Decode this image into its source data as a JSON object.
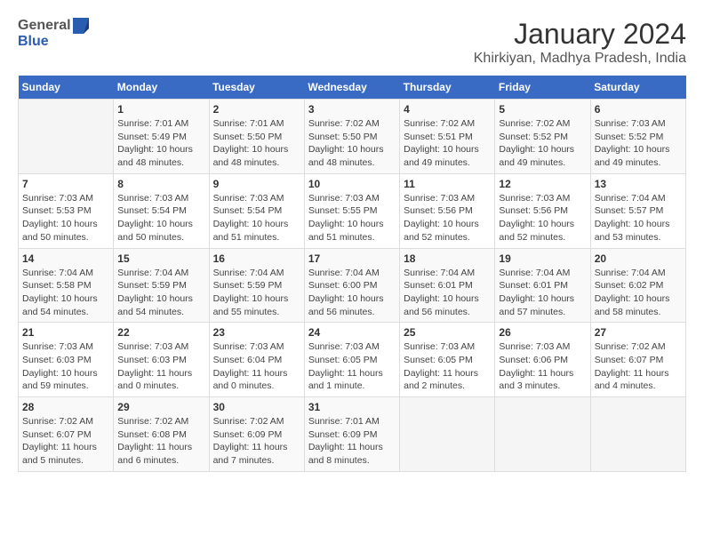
{
  "logo": {
    "line1": "General",
    "line2": "Blue"
  },
  "title": "January 2024",
  "subtitle": "Khirkiyan, Madhya Pradesh, India",
  "headers": [
    "Sunday",
    "Monday",
    "Tuesday",
    "Wednesday",
    "Thursday",
    "Friday",
    "Saturday"
  ],
  "weeks": [
    [
      {
        "day": "",
        "info": ""
      },
      {
        "day": "1",
        "info": "Sunrise: 7:01 AM\nSunset: 5:49 PM\nDaylight: 10 hours\nand 48 minutes."
      },
      {
        "day": "2",
        "info": "Sunrise: 7:01 AM\nSunset: 5:50 PM\nDaylight: 10 hours\nand 48 minutes."
      },
      {
        "day": "3",
        "info": "Sunrise: 7:02 AM\nSunset: 5:50 PM\nDaylight: 10 hours\nand 48 minutes."
      },
      {
        "day": "4",
        "info": "Sunrise: 7:02 AM\nSunset: 5:51 PM\nDaylight: 10 hours\nand 49 minutes."
      },
      {
        "day": "5",
        "info": "Sunrise: 7:02 AM\nSunset: 5:52 PM\nDaylight: 10 hours\nand 49 minutes."
      },
      {
        "day": "6",
        "info": "Sunrise: 7:03 AM\nSunset: 5:52 PM\nDaylight: 10 hours\nand 49 minutes."
      }
    ],
    [
      {
        "day": "7",
        "info": "Sunrise: 7:03 AM\nSunset: 5:53 PM\nDaylight: 10 hours\nand 50 minutes."
      },
      {
        "day": "8",
        "info": "Sunrise: 7:03 AM\nSunset: 5:54 PM\nDaylight: 10 hours\nand 50 minutes."
      },
      {
        "day": "9",
        "info": "Sunrise: 7:03 AM\nSunset: 5:54 PM\nDaylight: 10 hours\nand 51 minutes."
      },
      {
        "day": "10",
        "info": "Sunrise: 7:03 AM\nSunset: 5:55 PM\nDaylight: 10 hours\nand 51 minutes."
      },
      {
        "day": "11",
        "info": "Sunrise: 7:03 AM\nSunset: 5:56 PM\nDaylight: 10 hours\nand 52 minutes."
      },
      {
        "day": "12",
        "info": "Sunrise: 7:03 AM\nSunset: 5:56 PM\nDaylight: 10 hours\nand 52 minutes."
      },
      {
        "day": "13",
        "info": "Sunrise: 7:04 AM\nSunset: 5:57 PM\nDaylight: 10 hours\nand 53 minutes."
      }
    ],
    [
      {
        "day": "14",
        "info": "Sunrise: 7:04 AM\nSunset: 5:58 PM\nDaylight: 10 hours\nand 54 minutes."
      },
      {
        "day": "15",
        "info": "Sunrise: 7:04 AM\nSunset: 5:59 PM\nDaylight: 10 hours\nand 54 minutes."
      },
      {
        "day": "16",
        "info": "Sunrise: 7:04 AM\nSunset: 5:59 PM\nDaylight: 10 hours\nand 55 minutes."
      },
      {
        "day": "17",
        "info": "Sunrise: 7:04 AM\nSunset: 6:00 PM\nDaylight: 10 hours\nand 56 minutes."
      },
      {
        "day": "18",
        "info": "Sunrise: 7:04 AM\nSunset: 6:01 PM\nDaylight: 10 hours\nand 56 minutes."
      },
      {
        "day": "19",
        "info": "Sunrise: 7:04 AM\nSunset: 6:01 PM\nDaylight: 10 hours\nand 57 minutes."
      },
      {
        "day": "20",
        "info": "Sunrise: 7:04 AM\nSunset: 6:02 PM\nDaylight: 10 hours\nand 58 minutes."
      }
    ],
    [
      {
        "day": "21",
        "info": "Sunrise: 7:03 AM\nSunset: 6:03 PM\nDaylight: 10 hours\nand 59 minutes."
      },
      {
        "day": "22",
        "info": "Sunrise: 7:03 AM\nSunset: 6:03 PM\nDaylight: 11 hours\nand 0 minutes."
      },
      {
        "day": "23",
        "info": "Sunrise: 7:03 AM\nSunset: 6:04 PM\nDaylight: 11 hours\nand 0 minutes."
      },
      {
        "day": "24",
        "info": "Sunrise: 7:03 AM\nSunset: 6:05 PM\nDaylight: 11 hours\nand 1 minute."
      },
      {
        "day": "25",
        "info": "Sunrise: 7:03 AM\nSunset: 6:05 PM\nDaylight: 11 hours\nand 2 minutes."
      },
      {
        "day": "26",
        "info": "Sunrise: 7:03 AM\nSunset: 6:06 PM\nDaylight: 11 hours\nand 3 minutes."
      },
      {
        "day": "27",
        "info": "Sunrise: 7:02 AM\nSunset: 6:07 PM\nDaylight: 11 hours\nand 4 minutes."
      }
    ],
    [
      {
        "day": "28",
        "info": "Sunrise: 7:02 AM\nSunset: 6:07 PM\nDaylight: 11 hours\nand 5 minutes."
      },
      {
        "day": "29",
        "info": "Sunrise: 7:02 AM\nSunset: 6:08 PM\nDaylight: 11 hours\nand 6 minutes."
      },
      {
        "day": "30",
        "info": "Sunrise: 7:02 AM\nSunset: 6:09 PM\nDaylight: 11 hours\nand 7 minutes."
      },
      {
        "day": "31",
        "info": "Sunrise: 7:01 AM\nSunset: 6:09 PM\nDaylight: 11 hours\nand 8 minutes."
      },
      {
        "day": "",
        "info": ""
      },
      {
        "day": "",
        "info": ""
      },
      {
        "day": "",
        "info": ""
      }
    ]
  ]
}
